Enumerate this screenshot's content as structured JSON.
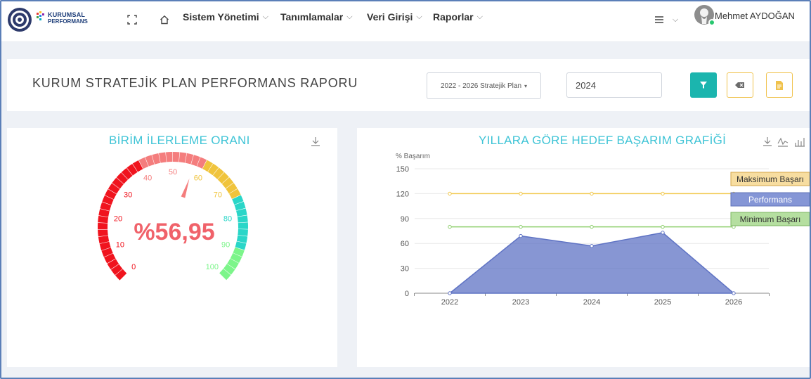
{
  "nav": {
    "logo_line1": "KURUMSAL",
    "logo_line2": "PERFORMANS",
    "menu": [
      {
        "label": "Sistem Yönetimi"
      },
      {
        "label": "Tanımlamalar"
      },
      {
        "label": "Veri Girişi"
      },
      {
        "label": "Raporlar"
      }
    ],
    "chevron": "⌵",
    "user_name": "Mehmet AYDOĞAN",
    "icons": [
      "fullscreen-icon",
      "home-icon",
      "hamburger-icon",
      "chevron-down-icon"
    ]
  },
  "header": {
    "title": "KURUM STRATEJİK PLAN PERFORMANS RAPORU",
    "plan_select": "2022 - 2026 Stratejik Plan",
    "year_value": "2024",
    "buttons": [
      "filter-icon",
      "eraser-icon",
      "document-icon"
    ]
  },
  "gauge": {
    "title": "BİRİM İLERLEME ORANI",
    "value_text": "%56,95",
    "value": 56.95,
    "min": 0,
    "max": 100,
    "tick_labels": [
      "0",
      "10",
      "20",
      "30",
      "40",
      "50",
      "60",
      "70",
      "80",
      "90",
      "100"
    ],
    "colors": {
      "red": "#f0141e",
      "salmon": "#f47d7d",
      "yellow": "#f0c43c",
      "teal": "#2ad6c8",
      "green": "#7cf58a"
    }
  },
  "chart": {
    "title": "YILLARA GÖRE HEDEF BAŞARIM GRAFİĞİ",
    "y_title": "% Başarım",
    "legend": [
      {
        "label": "Maksimum Başarı",
        "color": "#f7dda0",
        "border": "#d4a64a"
      },
      {
        "label": "Performans",
        "color": "#8596d6",
        "border": "#5f73b8"
      },
      {
        "label": "Minimum Başarı",
        "color": "#b5dfa0",
        "border": "#7bb561"
      }
    ]
  },
  "chart_data": {
    "type": "area",
    "x": [
      "2022",
      "2023",
      "2024",
      "2025",
      "2026"
    ],
    "y_ticks": [
      "0",
      "30",
      "60",
      "90",
      "120",
      "150"
    ],
    "ylim": [
      0,
      150
    ],
    "series": [
      {
        "name": "Maksimum Başarı",
        "type": "line",
        "color": "#f2c94c",
        "values": [
          120,
          120,
          120,
          120,
          120
        ]
      },
      {
        "name": "Performans",
        "type": "area",
        "color": "#5f73c4",
        "values": [
          0,
          69,
          57,
          73,
          0
        ]
      },
      {
        "name": "Minimum Başarı",
        "type": "line",
        "color": "#8fcf6e",
        "values": [
          80,
          80,
          80,
          80,
          80
        ]
      }
    ]
  }
}
